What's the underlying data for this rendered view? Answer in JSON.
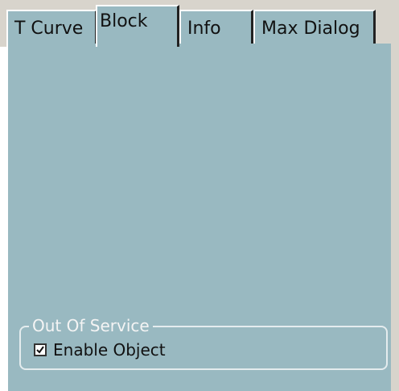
{
  "tabs": {
    "tcurve": "T Curve",
    "block": "Block",
    "info": "Info",
    "max_dialog": "Max Dialog",
    "active": "Block"
  },
  "group": {
    "title": "Out Of Service",
    "checkbox": {
      "label": "Enable Object",
      "checked": true
    }
  },
  "colors": {
    "panel": "#99b9c1",
    "chrome": "#d8d4cc"
  }
}
